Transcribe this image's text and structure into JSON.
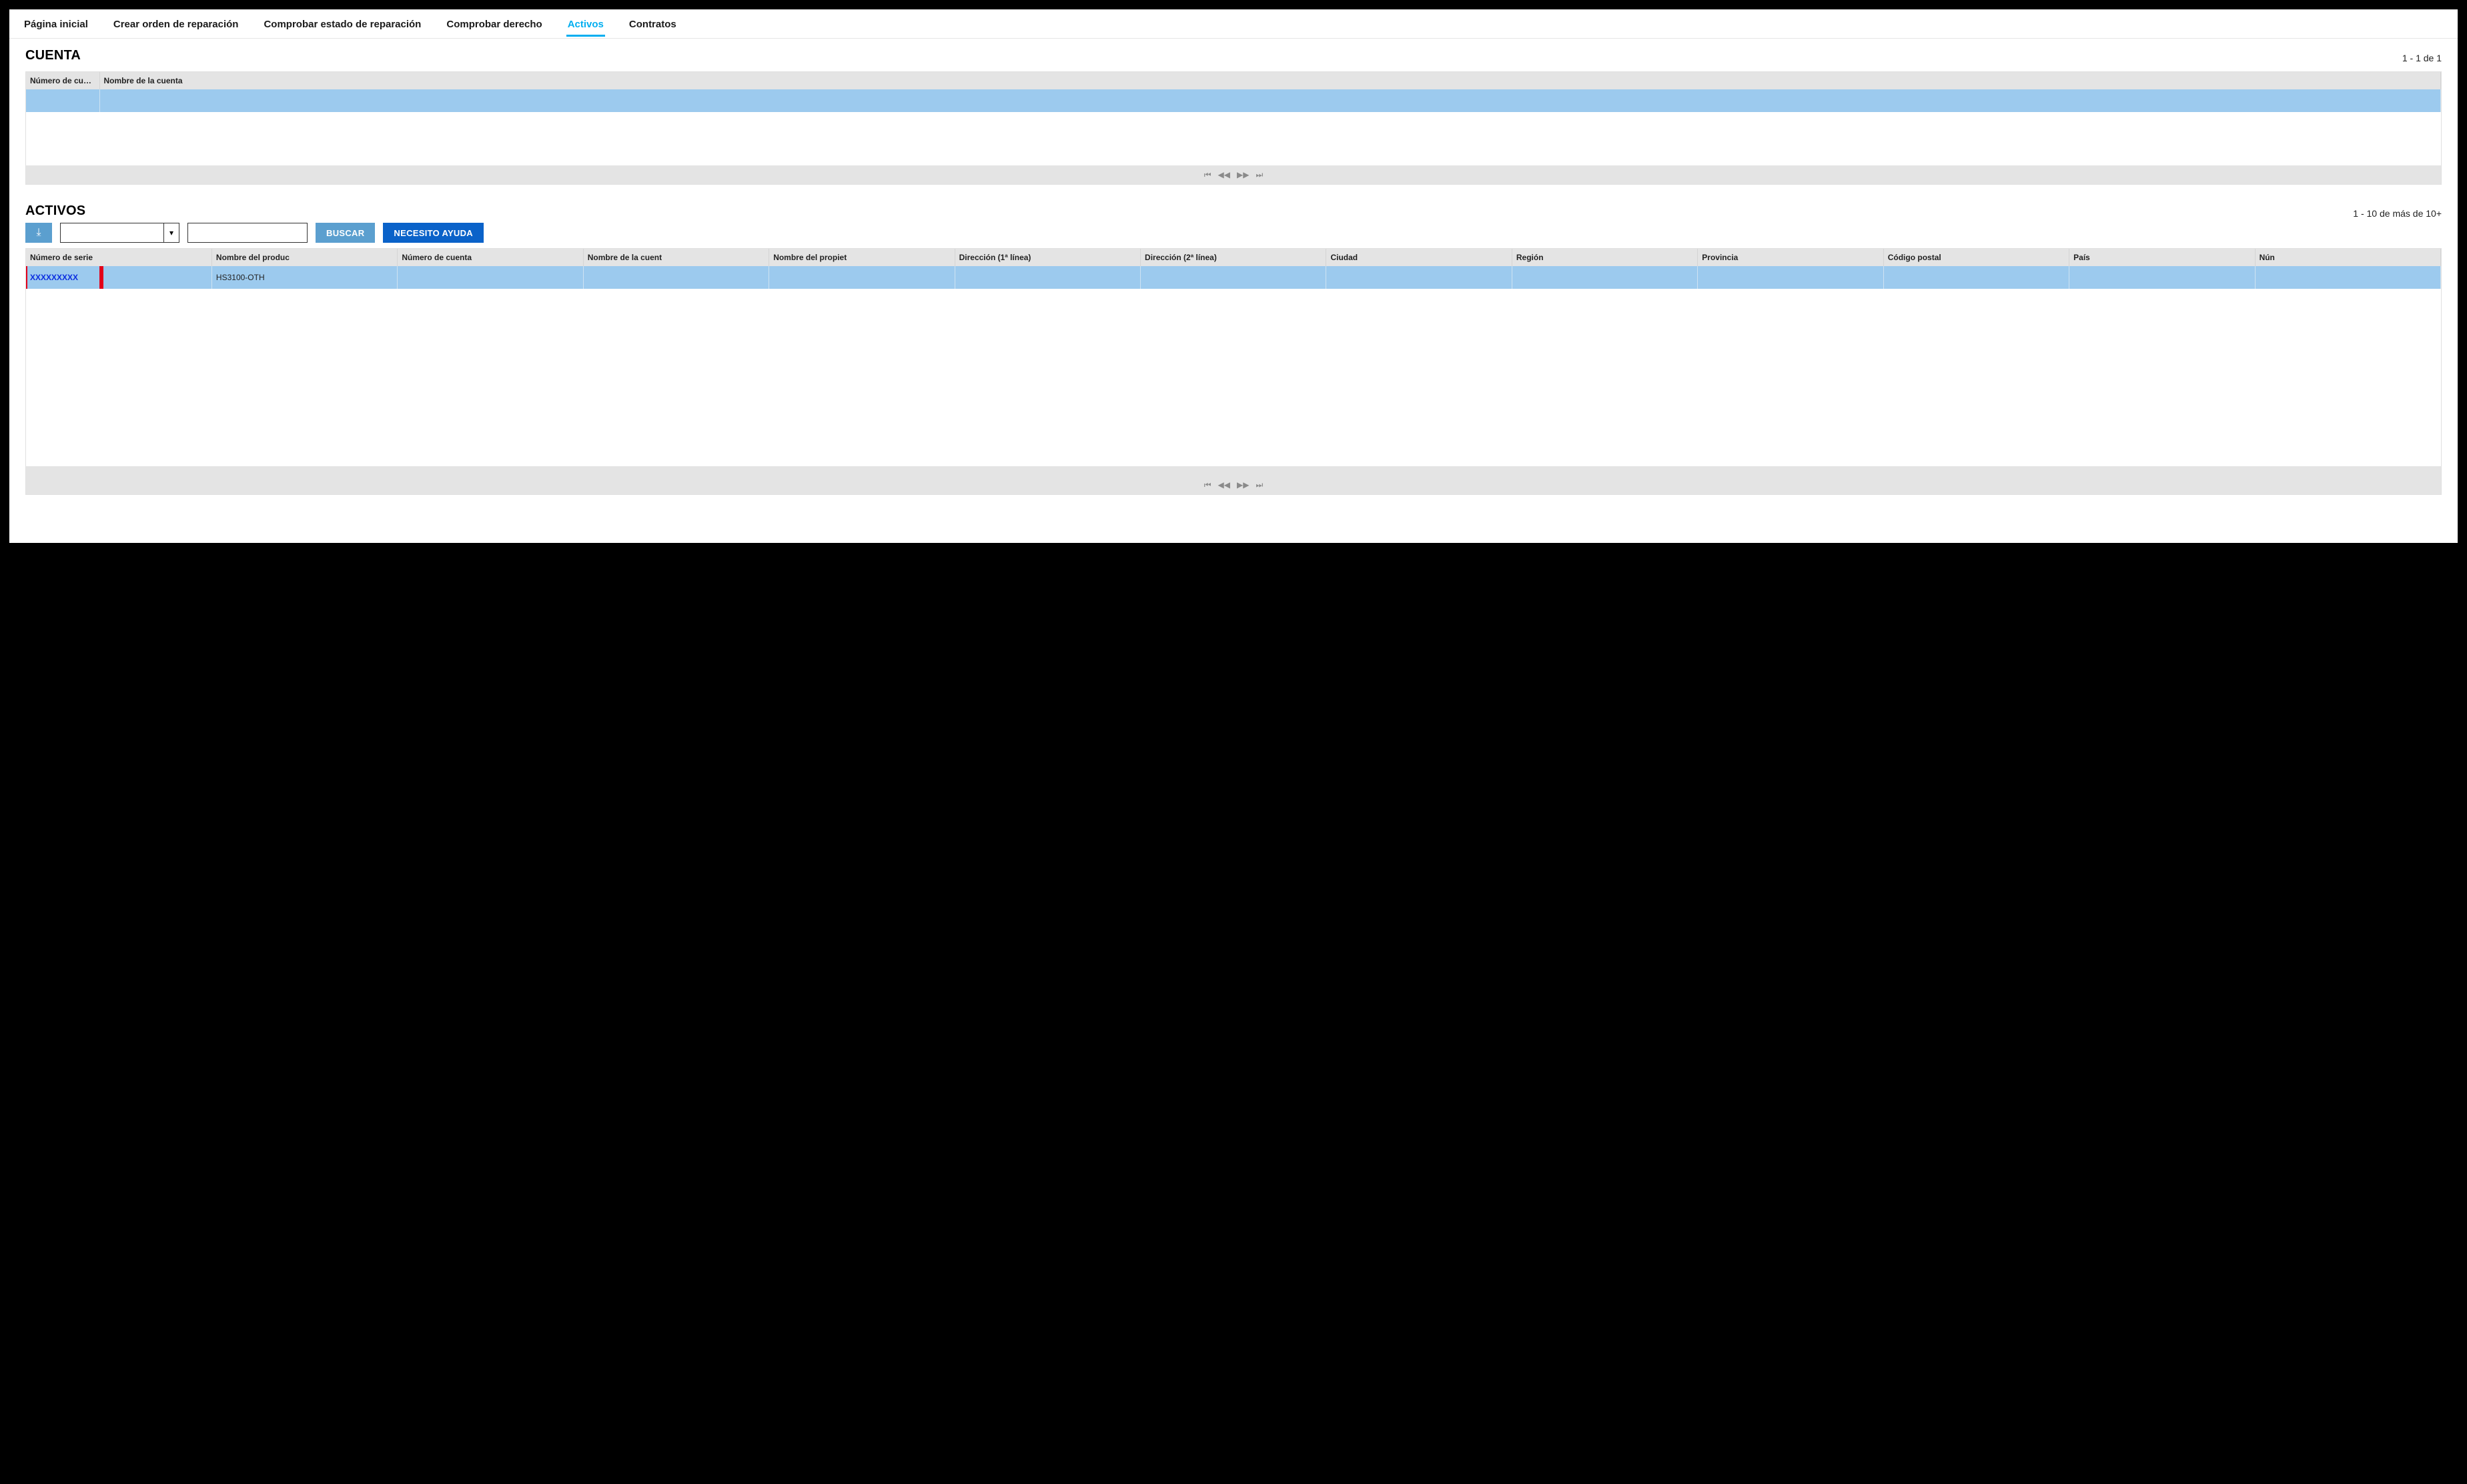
{
  "tabs": [
    {
      "label": "Página inicial",
      "active": false
    },
    {
      "label": "Crear orden de reparación",
      "active": false
    },
    {
      "label": "Comprobar estado de reparación",
      "active": false
    },
    {
      "label": "Comprobar derecho",
      "active": false
    },
    {
      "label": "Activos",
      "active": true
    },
    {
      "label": "Contratos",
      "active": false
    }
  ],
  "account": {
    "title": "CUENTA",
    "range": "1 - 1 de 1",
    "columns": [
      "Número de cuenta",
      "Nombre de la cuenta"
    ],
    "rows": [
      {
        "num": "",
        "name": ""
      }
    ]
  },
  "assets": {
    "title": "ACTIVOS",
    "range": "1 - 10 de más de 10+",
    "search_button": "BUSCAR",
    "help_button": "NECESITO AYUDA",
    "filter_value": "",
    "filter_text": "",
    "columns": [
      "Número de serie",
      "Nombre del produc",
      "Número de cuenta",
      "Nombre de la cuent",
      "Nombre del propiet",
      "Dirección (1ª línea)",
      "Dirección (2ª línea)",
      "Ciudad",
      "Región",
      "Provincia",
      "Código postal",
      "País",
      "Nún"
    ],
    "rows": [
      {
        "serial": "XXXXXXXXX",
        "product": "HS3100-OTH"
      }
    ]
  },
  "pager_glyphs": {
    "first": "⏮",
    "prev": "◀◀",
    "next": "▶▶",
    "last": "⏭"
  }
}
